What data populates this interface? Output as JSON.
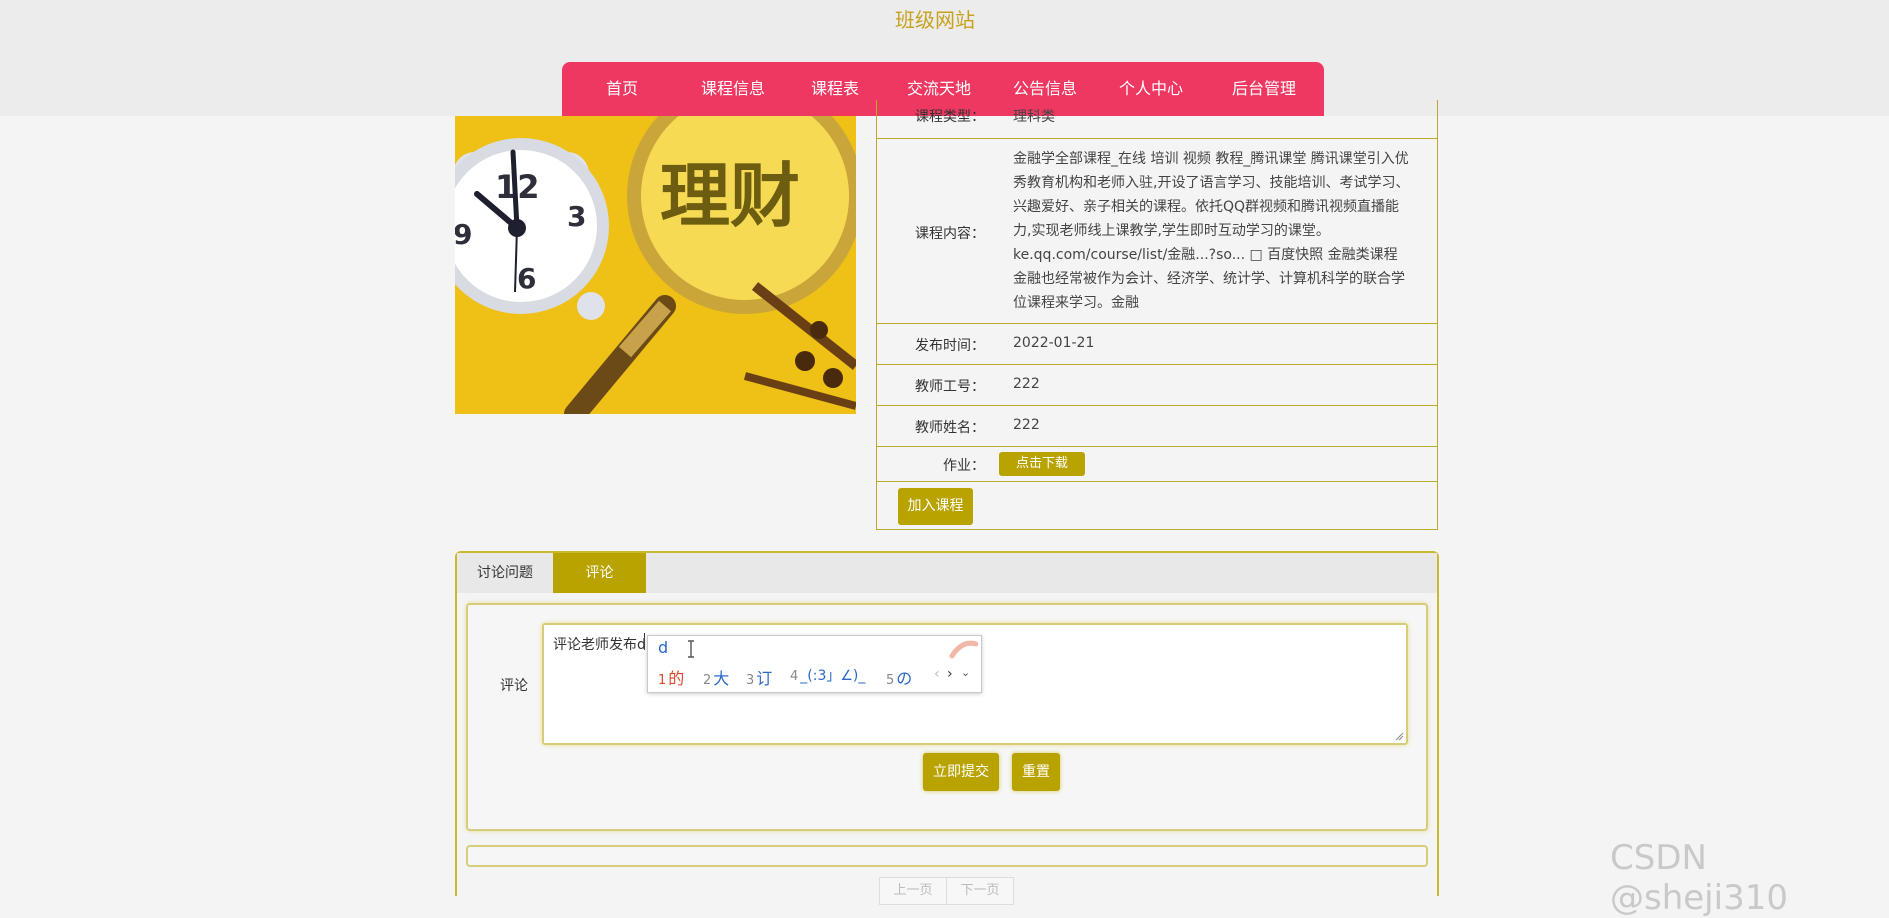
{
  "site_title": "班级网站",
  "nav": [
    "首页",
    "课程信息",
    "课程表",
    "交流天地",
    "公告信息",
    "个人中心",
    "后台管理"
  ],
  "course_image": {
    "text": "理财",
    "clock_digits": [
      "12",
      "3",
      "6",
      "9"
    ]
  },
  "details": {
    "type_label": "课程类型：",
    "type_value": "理科类",
    "content_label": "课程内容：",
    "content_value": "金融学全部课程_在线 培训 视频 教程_腾讯课堂 腾讯课堂引入优秀教育机构和老师入驻,开设了语言学习、技能培训、考试学习、兴趣爱好、亲子相关的课程。依托QQ群视频和腾讯视频直播能力,实现老师线上课教学,学生即时互动学习的课堂。 ke.qq.com/course/list/金融...?so... □ 百度快照 金融类课程 金融也经常被作为会计、经济学、统计学、计算机科学的联合学位课程来学习。金融",
    "date_label": "发布时间：",
    "date_value": "2022-01-21",
    "teacher_id_label": "教师工号：",
    "teacher_id_value": "222",
    "teacher_name_label": "教师姓名：",
    "teacher_name_value": "222",
    "homework_label": "作业：",
    "download_button": "点击下载",
    "join_button": "加入课程"
  },
  "tabs": [
    "讨论问题",
    "评论"
  ],
  "comment": {
    "label": "评论",
    "input_value": "评论老师发布d",
    "submit_button": "立即提交",
    "reset_button": "重置"
  },
  "ime": {
    "input": "d",
    "candidates": [
      {
        "n": "1",
        "text": "的"
      },
      {
        "n": "2",
        "text": "大"
      },
      {
        "n": "3",
        "text": "订"
      },
      {
        "n": "4",
        "text": "_(:3」∠)_"
      },
      {
        "n": "5",
        "text": "の"
      }
    ]
  },
  "pager": {
    "prev": "上一页",
    "next": "下一页"
  },
  "watermark": "CSDN @sheji310"
}
